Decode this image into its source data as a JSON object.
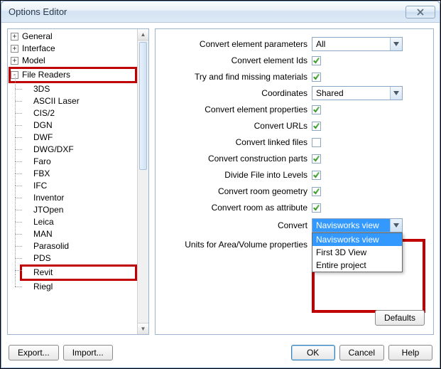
{
  "window": {
    "title": "Options Editor"
  },
  "tree": {
    "top": [
      {
        "exp": "+",
        "label": "General"
      },
      {
        "exp": "+",
        "label": "Interface"
      },
      {
        "exp": "+",
        "label": "Model"
      }
    ],
    "file_readers_label": "File Readers",
    "children": [
      "3DS",
      "ASCII Laser",
      "CIS/2",
      "DGN",
      "DWF",
      "DWG/DXF",
      "Faro",
      "FBX",
      "IFC",
      "Inventor",
      "JTOpen",
      "Leica",
      "MAN",
      "Parasolid",
      "PDS",
      "Revit",
      "Riegl"
    ]
  },
  "opts": {
    "convert_params": "Convert element parameters",
    "convert_ids": "Convert element Ids",
    "find_missing": "Try and find missing materials",
    "coordinates": "Coordinates",
    "convert_props": "Convert element properties",
    "convert_urls": "Convert URLs",
    "convert_linked": "Convert linked files",
    "convert_ctor": "Convert construction parts",
    "divide_levels": "Divide File into Levels",
    "convert_room_geom": "Convert room geometry",
    "convert_room_attr": "Convert room as attribute",
    "convert": "Convert",
    "units_label": "Units for Area/Volume properties"
  },
  "values": {
    "params": "All",
    "coordinates": "Shared",
    "convert": "Navisworks view",
    "convert_options": [
      "Navisworks view",
      "First 3D View",
      "Entire project"
    ]
  },
  "buttons": {
    "defaults": "Defaults",
    "export": "Export...",
    "import": "Import...",
    "ok": "OK",
    "cancel": "Cancel",
    "help": "Help"
  }
}
